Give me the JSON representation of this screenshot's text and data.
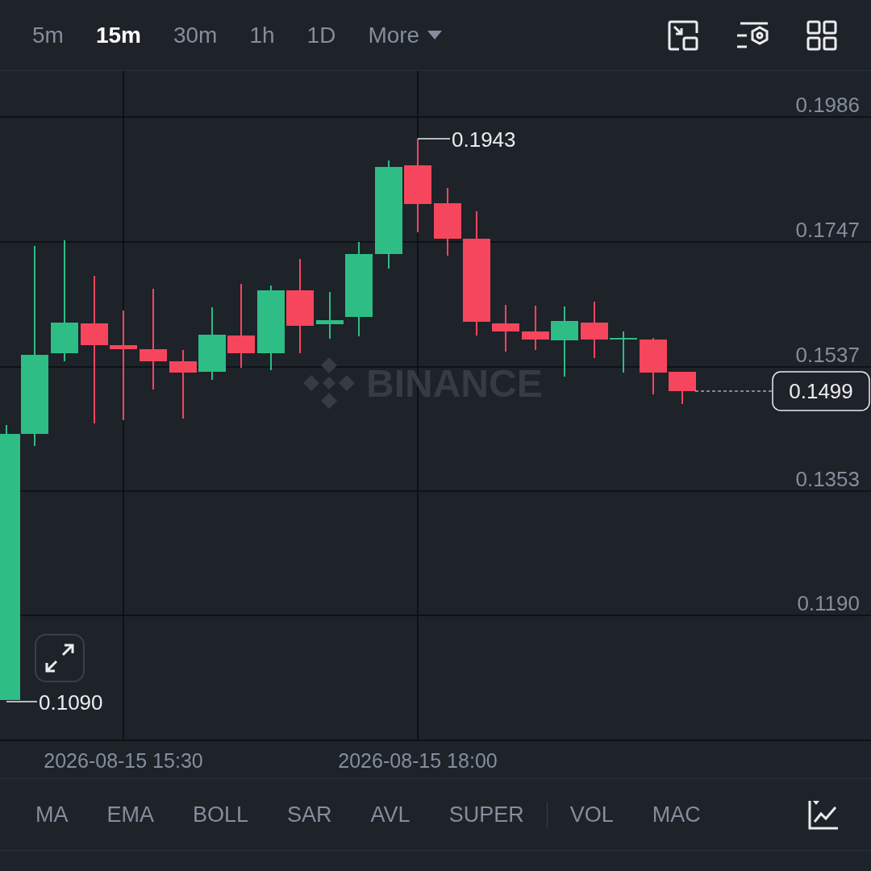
{
  "timeframes": [
    {
      "label": "5m",
      "selected": false
    },
    {
      "label": "15m",
      "selected": true
    },
    {
      "label": "30m",
      "selected": false
    },
    {
      "label": "1h",
      "selected": false
    },
    {
      "label": "1D",
      "selected": false
    }
  ],
  "more": {
    "label": "More"
  },
  "chart": {
    "watermark": "BINANCE",
    "price_labels": [
      "0.1986",
      "0.1747",
      "0.1537",
      "0.1353",
      "0.1190"
    ],
    "time_labels": [
      "2026-08-15 15:30",
      "2026-08-15 18:00"
    ],
    "high_label": "0.1943",
    "low_label": "0.1090",
    "last_price": "0.1499"
  },
  "indicators": {
    "main": [
      "MA",
      "EMA",
      "BOLL",
      "SAR",
      "AVL",
      "SUPER"
    ],
    "sub": [
      "VOL",
      "MAC"
    ]
  }
}
